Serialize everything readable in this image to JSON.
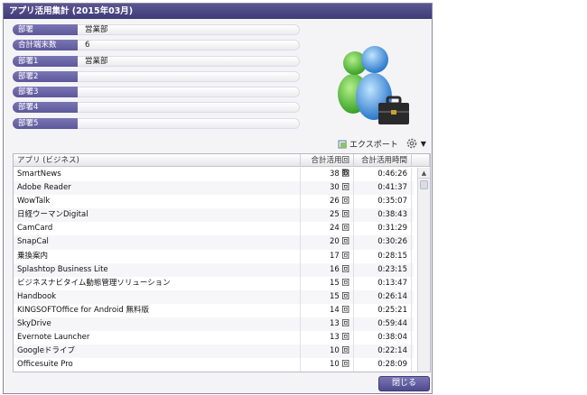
{
  "window": {
    "title": "アプリ活用集計 (2015年03月)"
  },
  "info_rows": [
    {
      "label": "部署",
      "value": "営業部"
    },
    {
      "label": "合計端末数",
      "value": "6"
    },
    {
      "label": "部署1",
      "value": "営業部"
    },
    {
      "label": "部署2",
      "value": ""
    },
    {
      "label": "部署3",
      "value": ""
    },
    {
      "label": "部署4",
      "value": ""
    },
    {
      "label": "部署5",
      "value": ""
    }
  ],
  "toolbar": {
    "export_label": "エクスポート",
    "caret": "▼"
  },
  "table": {
    "headers": [
      "アプリ (ビジネス)",
      "合計活用回数",
      "合計活用時間"
    ],
    "rows": [
      {
        "app": "SmartNews",
        "count": "38 回",
        "time": "0:46:26"
      },
      {
        "app": "Adobe Reader",
        "count": "30 回",
        "time": "0:41:37"
      },
      {
        "app": "WowTalk",
        "count": "26 回",
        "time": "0:35:07"
      },
      {
        "app": "日経ウーマンDigital",
        "count": "25 回",
        "time": "0:38:43"
      },
      {
        "app": "CamCard",
        "count": "24 回",
        "time": "0:31:29"
      },
      {
        "app": "SnapCal",
        "count": "20 回",
        "time": "0:30:26"
      },
      {
        "app": "乗換案内",
        "count": "17 回",
        "time": "0:28:15"
      },
      {
        "app": "Splashtop Business Lite",
        "count": "16 回",
        "time": "0:23:15"
      },
      {
        "app": "ビジネスナビタイム動態管理ソリューション",
        "count": "15 回",
        "time": "0:13:47"
      },
      {
        "app": "Handbook",
        "count": "15 回",
        "time": "0:26:14"
      },
      {
        "app": "KINGSOFTOffice for Android 無料版",
        "count": "14 回",
        "time": "0:25:21"
      },
      {
        "app": "SkyDrive",
        "count": "13 回",
        "time": "0:59:44"
      },
      {
        "app": "Evernote Launcher",
        "count": "13 回",
        "time": "0:38:04"
      },
      {
        "app": "Googleドライブ",
        "count": "10 回",
        "time": "0:22:14"
      },
      {
        "app": "Officesuite Pro",
        "count": "10 回",
        "time": "0:28:09"
      }
    ]
  },
  "footer": {
    "close_label": "閉じる"
  },
  "colors": {
    "title_bg": "#3f3b78",
    "label_bg": "#6c68a8",
    "close_bg": "#5c589a"
  }
}
